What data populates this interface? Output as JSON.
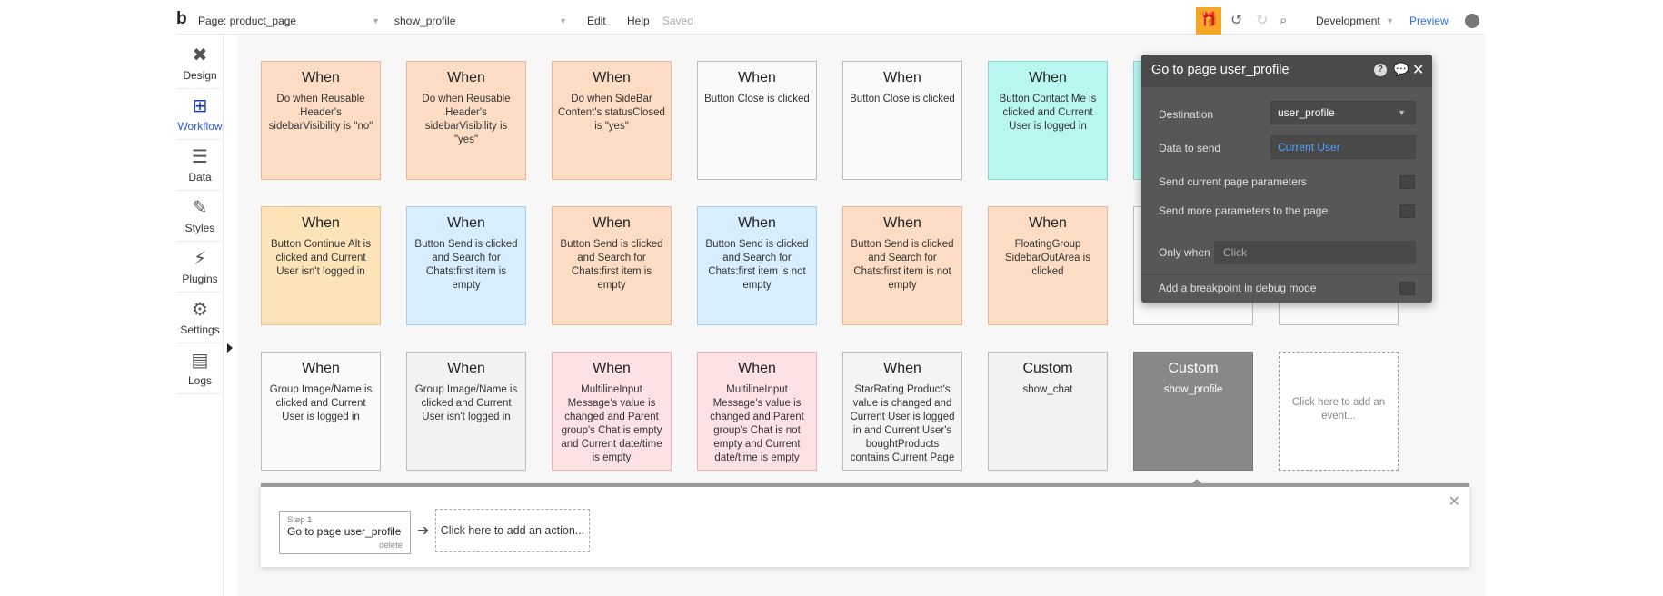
{
  "topbar": {
    "logo": "b",
    "page_selector": "Page: product_page",
    "workflow_selector": "show_profile",
    "menu_edit": "Edit",
    "menu_help": "Help",
    "saved_status": "Saved",
    "environment": "Development",
    "preview": "Preview"
  },
  "sidebar": {
    "items": [
      {
        "label": "Design"
      },
      {
        "label": "Workflow"
      },
      {
        "label": "Data"
      },
      {
        "label": "Styles"
      },
      {
        "label": "Plugins"
      },
      {
        "label": "Settings"
      },
      {
        "label": "Logs"
      }
    ]
  },
  "events": {
    "row1": [
      {
        "title": "When",
        "text": "Do when Reusable Header's sidebarVisibility is \"no\""
      },
      {
        "title": "When",
        "text": "Do when Reusable Header's sidebarVisibility is \"yes\""
      },
      {
        "title": "When",
        "text": "Do when SideBar Content's statusClosed is \"yes\""
      },
      {
        "title": "When",
        "text": "Button Close is clicked"
      },
      {
        "title": "When",
        "text": "Button Close is clicked"
      },
      {
        "title": "When",
        "text": "Button Contact Me is clicked and Current User is logged in"
      }
    ],
    "row2": [
      {
        "title": "When",
        "text": "Button Continue Alt is clicked and Current User isn't logged in"
      },
      {
        "title": "When",
        "text": "Button Send is clicked and Search for Chats:first item is empty"
      },
      {
        "title": "When",
        "text": "Button Send is clicked and Search for Chats:first item is empty"
      },
      {
        "title": "When",
        "text": "Button Send is clicked and Search for Chats:first item is not empty"
      },
      {
        "title": "When",
        "text": "Button Send is clicked and Search for Chats:first item is not empty"
      },
      {
        "title": "When",
        "text": "FloatingGroup SidebarOutArea is clicked"
      }
    ],
    "row3": [
      {
        "title": "When",
        "text": "Group Image/Name is clicked and Current User is logged in"
      },
      {
        "title": "When",
        "text": "Group Image/Name is clicked and Current User isn't logged in"
      },
      {
        "title": "When",
        "text": "MultilineInput Message's value is changed and Parent group's Chat is empty and Current date/time is empty"
      },
      {
        "title": "When",
        "text": "MultilineInput Message's value is changed and Parent group's Chat is not empty and Current date/time is empty"
      },
      {
        "title": "When",
        "text": "StarRating Product's value is changed and Current User is logged in and Current User's boughtProducts contains Current Page Product"
      },
      {
        "title": "Custom",
        "text": "show_chat"
      },
      {
        "title": "Custom",
        "text": "show_profile"
      },
      {
        "text": "Click here to add an event..."
      }
    ]
  },
  "action_panel": {
    "step_label": "Step 1",
    "step_name": "Go to page user_profile",
    "step_delete": "delete",
    "add_action": "Click here to add an action..."
  },
  "property_editor": {
    "title": "Go to page user_profile",
    "destination_label": "Destination",
    "destination_value": "user_profile",
    "data_label": "Data to send",
    "data_value": "Current User",
    "send_current_params": "Send current page parameters",
    "send_more_params": "Send more parameters to the page",
    "only_when_label": "Only when",
    "only_when_placeholder": "Click",
    "breakpoint_label": "Add a breakpoint in debug mode"
  },
  "colors": {
    "accent": "#2a6fdb",
    "gift": "#f5a623",
    "selected_event": "#888888",
    "panel_bg": "#575757"
  }
}
